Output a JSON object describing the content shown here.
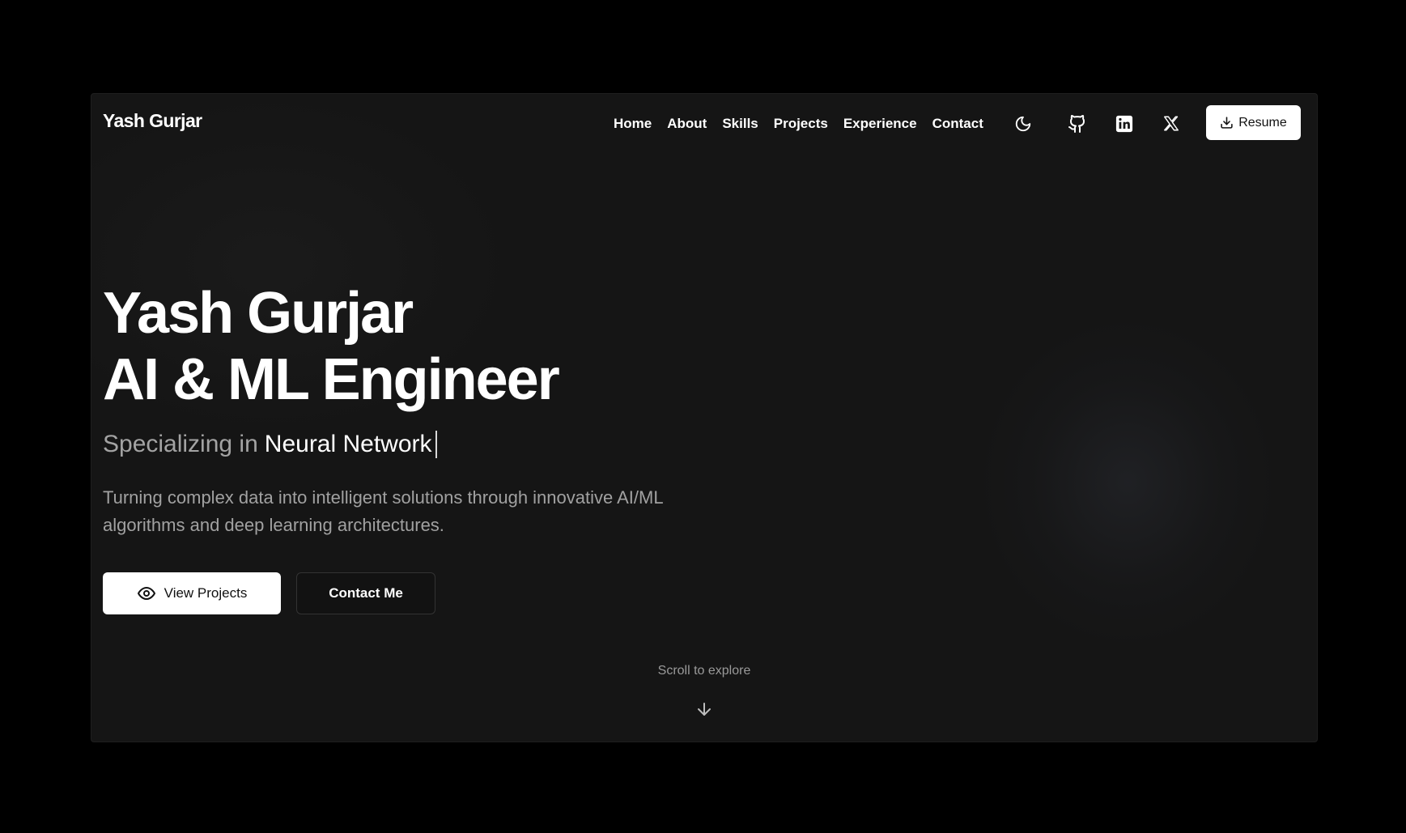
{
  "header": {
    "brand": "Yash Gurjar",
    "nav": [
      "Home",
      "About",
      "Skills",
      "Projects",
      "Experience",
      "Contact"
    ],
    "icons": [
      "moon-icon",
      "github-icon",
      "linkedin-icon",
      "x-icon"
    ],
    "resume_label": "Resume"
  },
  "hero": {
    "line1": "Yash Gurjar",
    "line2": "AI & ML Engineer",
    "specializing_prefix": "Specializing in",
    "specializing_word": "Neural Network",
    "description": "Turning complex data into intelligent solutions through innovative AI/ML algorithms and deep learning architectures.",
    "primary_button": "View Projects",
    "secondary_button": "Contact Me"
  },
  "scroll": {
    "label": "Scroll to explore"
  },
  "colors": {
    "page_bg": "#000000",
    "window_bg": "#151515",
    "text_primary": "#ffffff",
    "text_muted": "#a1a1a1",
    "button_bg": "#ffffff"
  }
}
